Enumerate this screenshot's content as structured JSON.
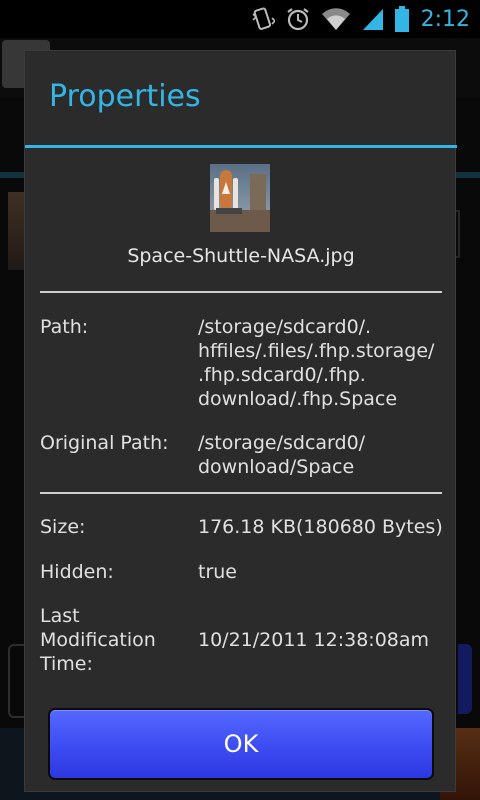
{
  "status_bar": {
    "time": "2:12",
    "icons": [
      "vibrate-icon",
      "alarm-icon",
      "wifi-icon",
      "signal-icon",
      "battery-icon"
    ],
    "accent_color": "#33b5e5"
  },
  "dialog": {
    "title": "Properties",
    "file_name": "Space-Shuttle-NASA.jpg",
    "properties": {
      "path_label": "Path:",
      "path_lines": [
        "/storage/sdcard0/.",
        "hffiles/.files/.fhp.storage/",
        ".fhp.sdcard0/.fhp.",
        "download/.fhp.Space"
      ],
      "original_path_label": "Original Path:",
      "original_path_lines": [
        "/storage/sdcard0/",
        "download/Space"
      ],
      "size_label": "Size:",
      "size_value": "176.18 KB(180680 Bytes)",
      "hidden_label": "Hidden:",
      "hidden_value": "true",
      "last_mod_label_lines": [
        "Last",
        "Modification",
        "Time:"
      ],
      "last_mod_value": "10/21/2011 12:38:08am"
    },
    "ok_label": "OK"
  }
}
